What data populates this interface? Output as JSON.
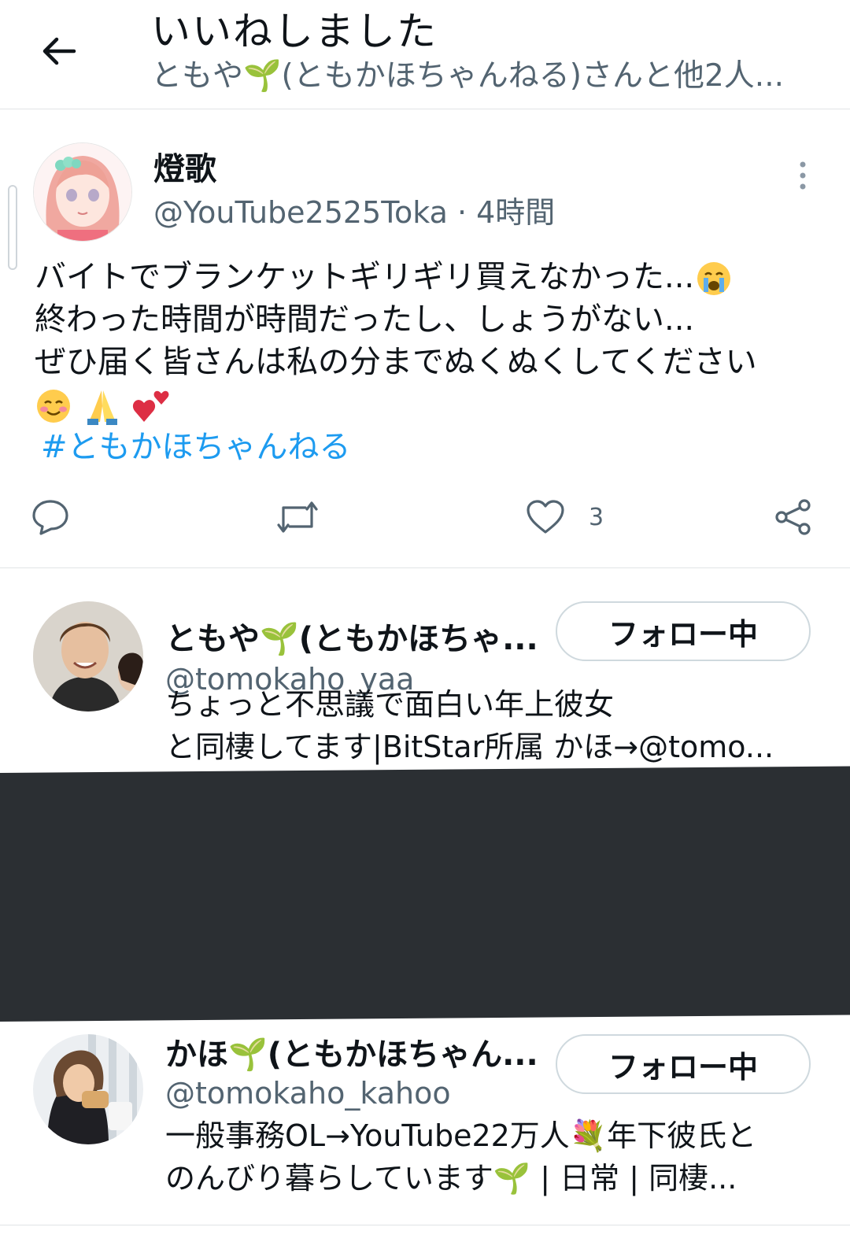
{
  "header": {
    "title": "いいねしました",
    "subtitle": "ともや🌱(ともかほちゃんねる)さんと他2人..."
  },
  "tweet": {
    "author_name": "燈歌",
    "handle": "@YouTube2525Toka",
    "time": "4時間",
    "meta": "@YouTube2525Toka · 4時間",
    "lines": [
      "バイトでブランケットギリギリ買えなかった...",
      "終わった時間が時間だったし、しょうがない...",
      "ぜひ届く皆さんは私の分までぬくぬくしてください"
    ],
    "hashtag": "#ともかほちゃんねる",
    "like_count": "3"
  },
  "users": [
    {
      "name": "ともや🌱(ともかほちゃ...",
      "handle": "@tomokaho_yaa",
      "bio_lines": [
        "ちょっと不思議で面白い年上彼女",
        "と同棲してます|BitStar所属 かほ→@tomo..."
      ],
      "follow_label": "フォロー中"
    },
    {
      "name": "かほ🌱(ともかほちゃん...",
      "handle": "@tomokaho_kahoo",
      "bio_lines": [
        "一般事務OL→YouTube22万人💐年下彼氏と",
        "のんびり暮らしています🌱 | 日常 | 同棲..."
      ],
      "follow_label": "フォロー中"
    }
  ],
  "colors": {
    "link": "#1d9bf0",
    "secondary_text": "#536471",
    "divider": "#e1e4e6",
    "dark_band": "#2b2f33"
  },
  "icons": [
    "back-arrow-icon",
    "more-vertical-icon",
    "reply-icon",
    "retweet-icon",
    "heart-icon",
    "share-icon",
    "crying-face-emoji",
    "smiling-blush-emoji",
    "folded-hands-emoji",
    "two-hearts-emoji",
    "seedling-emoji",
    "bouquet-emoji"
  ]
}
